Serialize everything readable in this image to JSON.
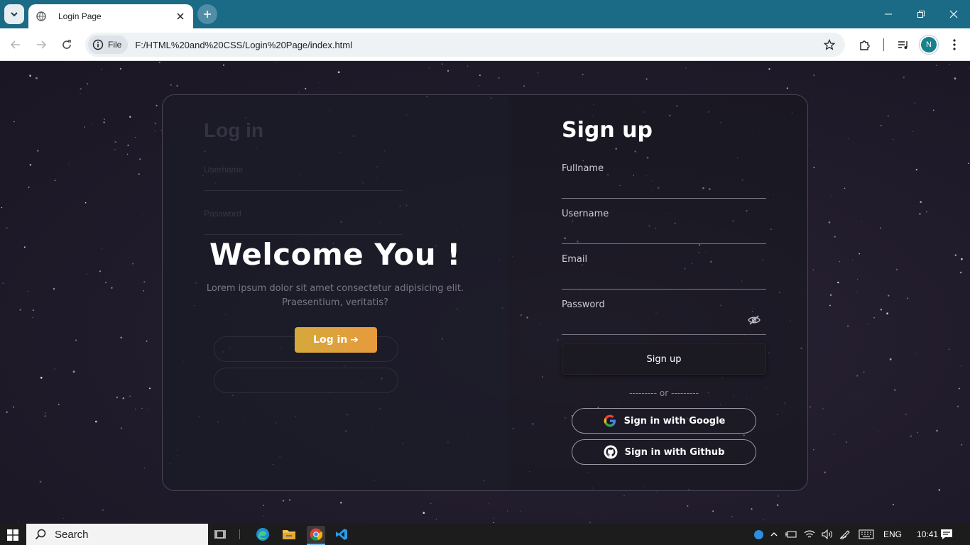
{
  "browser": {
    "tab_title": "Login Page",
    "chip_label": "File",
    "url": "F:/HTML%20and%20CSS/Login%20Page/index.html",
    "profile_initial": "N"
  },
  "page": {
    "ghost_login_title": "Log in",
    "ghost_username_label": "Username",
    "ghost_password_label": "Password",
    "welcome_title": "Welcome You !",
    "welcome_subtitle": "Lorem ipsum dolor sit amet consectetur adipisicing elit. Praesentium, veritatis?",
    "login_button": "Log in",
    "login_arrow": "➔",
    "signup_title": "Sign up",
    "fields": [
      {
        "label": "Fullname",
        "value": ""
      },
      {
        "label": "Username",
        "value": ""
      },
      {
        "label": "Email",
        "value": ""
      },
      {
        "label": "Password",
        "value": ""
      }
    ],
    "signup_button": "Sign up",
    "or_divider": "--------- or ---------",
    "google_button": "Sign in with Google",
    "github_button": "Sign in with Github"
  },
  "taskbar": {
    "search_label": "Search",
    "language": "ENG",
    "time": "10:41"
  },
  "colors": {
    "titlebar": "#1b6a86",
    "login_gradient_start": "#d4a93b",
    "login_gradient_end": "#e89a3c"
  },
  "icons": [
    "chevron-down-icon",
    "globe-icon",
    "close-icon",
    "plus-icon",
    "minimize-icon",
    "restore-icon",
    "back-icon",
    "forward-icon",
    "reload-icon",
    "info-icon",
    "star-icon",
    "extensions-icon",
    "media-icon",
    "menu-icon",
    "eye-off-icon",
    "google-icon",
    "github-icon",
    "windows-icon",
    "search-icon",
    "task-view-icon",
    "edge-icon",
    "explorer-icon",
    "chrome-icon",
    "vscode-icon"
  ]
}
